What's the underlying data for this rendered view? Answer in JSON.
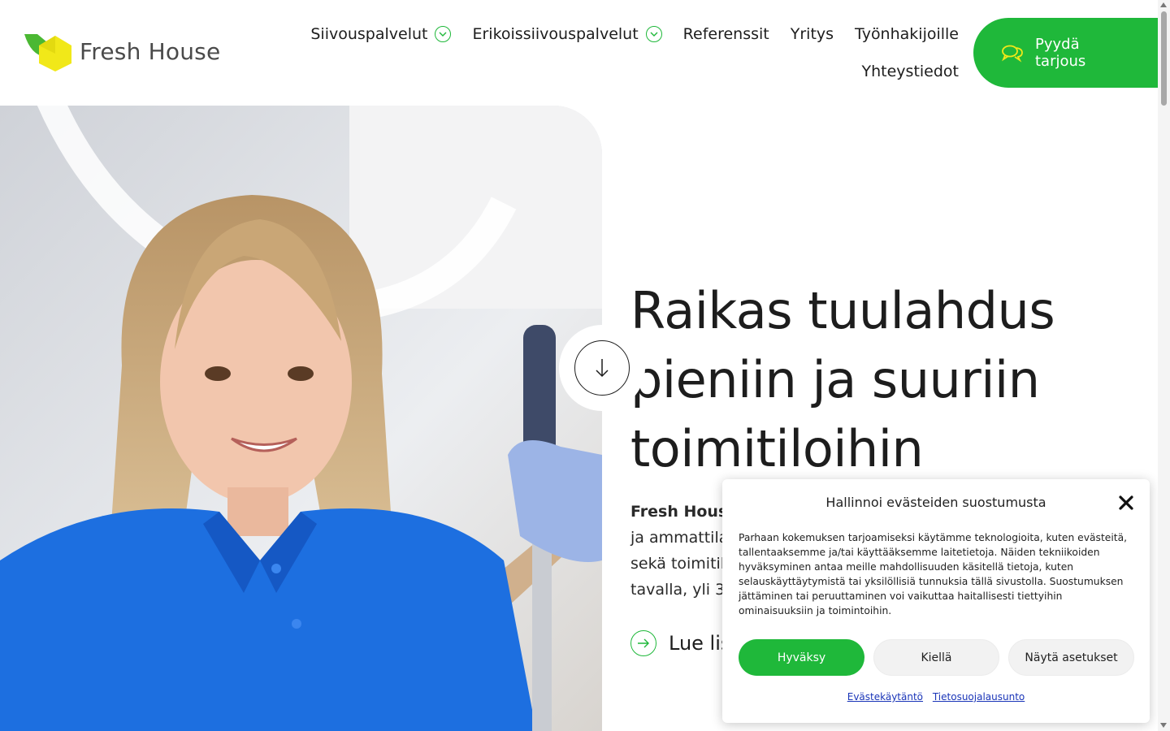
{
  "brand": {
    "name": "Fresh House",
    "logo_icon": "house-leaf-logo",
    "colors": {
      "accent": "#1fb83a",
      "logo_yellow": "#f1e819",
      "logo_green": "#4bb833",
      "link_blue": "#1a35b8"
    }
  },
  "nav": {
    "items": [
      {
        "label": "Siivouspalvelut",
        "has_dropdown": true
      },
      {
        "label": "Erikoissiivouspalvelut",
        "has_dropdown": true
      },
      {
        "label": "Referenssit",
        "has_dropdown": false
      },
      {
        "label": "Yritys",
        "has_dropdown": false
      },
      {
        "label": "Työnhakijoille",
        "has_dropdown": false
      },
      {
        "label": "Yhteystiedot",
        "has_dropdown": false
      }
    ],
    "dropdown_icon": "chevron-down-circle-icon"
  },
  "cta": {
    "label": "Pyydä tarjous",
    "icon": "chat-bubbles-icon"
  },
  "hero": {
    "heading": "Raikas tuulahdus pieniin ja suuriin toimitiloihin",
    "paragraph_bold": "Fresh House",
    "paragraph_lines": [
      "ja ammattila",
      "sekä toimitil",
      "tavalla, yli 3"
    ],
    "read_more_label": "Lue lis",
    "read_more_icon": "arrow-right-circle-icon",
    "scroll_icon": "arrow-down-circle-icon",
    "image_description_icon": "hero-photo"
  },
  "cookie_dialog": {
    "title": "Hallinnoi evästeiden suostumusta",
    "body": "Parhaan kokemuksen tarjoamiseksi käytämme teknologioita, kuten evästeitä, tallentaaksemme ja/tai käyttääksemme laitetietoja. Näiden tekniikoiden hyväksyminen antaa meille mahdollisuuden käsitellä tietoja, kuten selauskäyttäytymistä tai yksilöllisiä tunnuksia tällä sivustolla. Suostumuksen jättäminen tai peruuttaminen voi vaikuttaa haitallisesti tiettyihin ominaisuuksiin ja toimintoihin.",
    "accept_label": "Hyväksy",
    "deny_label": "Kiellä",
    "preferences_label": "Näytä asetukset",
    "links": [
      "Evästekäytäntö",
      "Tietosuojalausunto"
    ],
    "close_icon": "close-icon"
  }
}
